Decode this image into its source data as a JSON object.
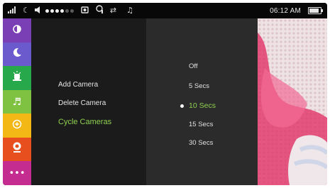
{
  "status_bar": {
    "icons": [
      "signal-icon",
      "moon-icon",
      "volume-icon",
      "camera-icon",
      "temperature-icon",
      "repeat-icon",
      "music-icon"
    ],
    "volume_level": 0.6,
    "time": "06:12 AM",
    "battery_level": 0.85
  },
  "sidebar": {
    "items": [
      {
        "icon": "brightness-icon",
        "color": "#7b3fb5"
      },
      {
        "icon": "moon-icon",
        "color": "#6a5acd"
      },
      {
        "icon": "alarm-icon",
        "color": "#27a84a"
      },
      {
        "icon": "music-icon",
        "color": "#7fc241"
      },
      {
        "icon": "zoom-icon",
        "color": "#f3b716"
      },
      {
        "icon": "camera-icon",
        "color": "#e84f1e",
        "selected": true
      },
      {
        "icon": "more-icon",
        "color": "#c52c8f"
      }
    ]
  },
  "menu": {
    "items": [
      "Add Camera",
      "Delete Camera",
      "Cycle Cameras"
    ],
    "active": "Cycle Cameras"
  },
  "submenu": {
    "items": [
      "Off",
      "5 Secs",
      "10 Secs",
      "15 Secs",
      "30 Secs"
    ],
    "selected": "10 Secs"
  },
  "colors": {
    "accent_green": "#8fd14f",
    "background": "#232323"
  }
}
